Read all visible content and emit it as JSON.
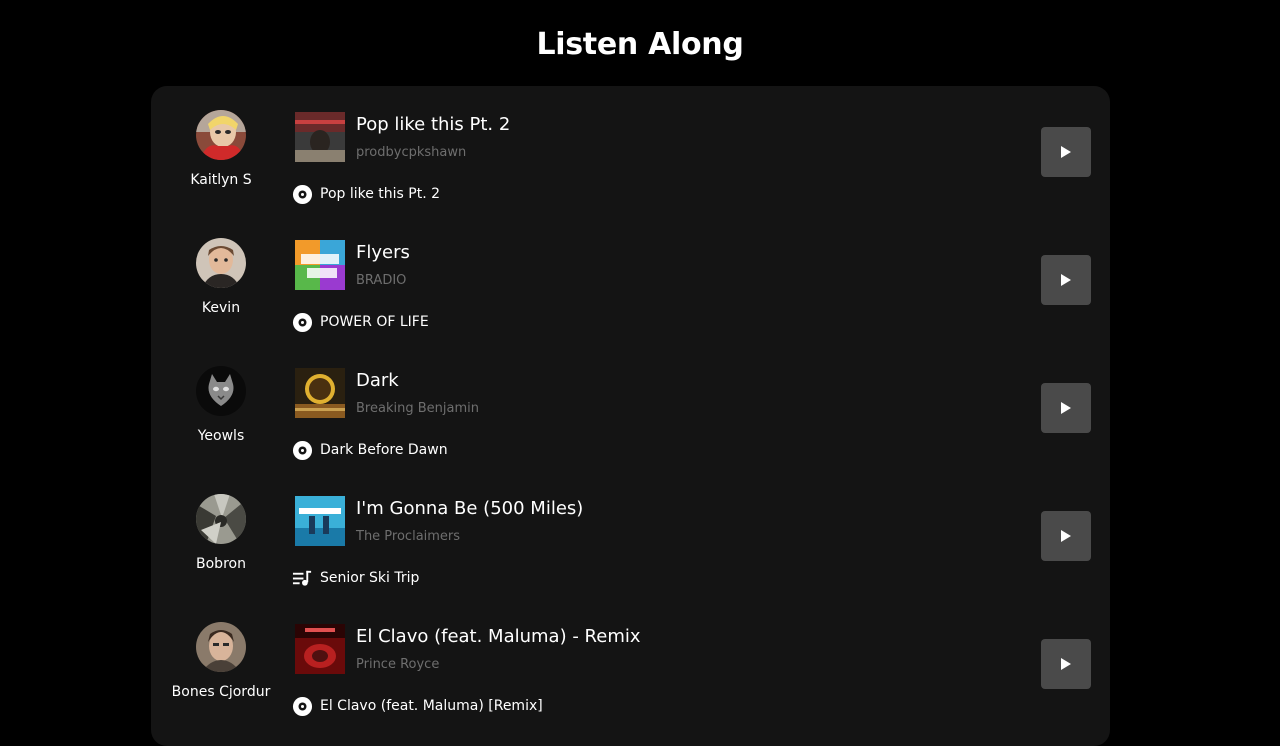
{
  "page": {
    "title": "Listen Along"
  },
  "colors": {
    "background": "#000000",
    "panel": "#141414",
    "play_button": "#4a4a4a",
    "artist_text": "#6e6e6e"
  },
  "rows": [
    {
      "user": "Kaitlyn S",
      "track": "Pop like this Pt. 2",
      "artist": "prodbycpkshawn",
      "context_type": "album",
      "context_icon": "album-disc-icon",
      "context": "Pop like this Pt. 2"
    },
    {
      "user": "Kevin",
      "track": "Flyers",
      "artist": "BRADIO",
      "context_type": "album",
      "context_icon": "album-disc-icon",
      "context": "POWER OF LIFE"
    },
    {
      "user": "Yeowls",
      "track": "Dark",
      "artist": "Breaking Benjamin",
      "context_type": "album",
      "context_icon": "album-disc-icon",
      "context": "Dark Before Dawn"
    },
    {
      "user": "Bobron",
      "track": "I'm Gonna Be (500 Miles)",
      "artist": "The Proclaimers",
      "context_type": "playlist",
      "context_icon": "playlist-icon",
      "context": "Senior Ski Trip"
    },
    {
      "user": "Bones Cjordur",
      "track": "El Clavo (feat. Maluma) - Remix",
      "artist": "Prince Royce",
      "context_type": "album",
      "context_icon": "album-disc-icon",
      "context": "El Clavo (feat. Maluma) [Remix]"
    }
  ]
}
